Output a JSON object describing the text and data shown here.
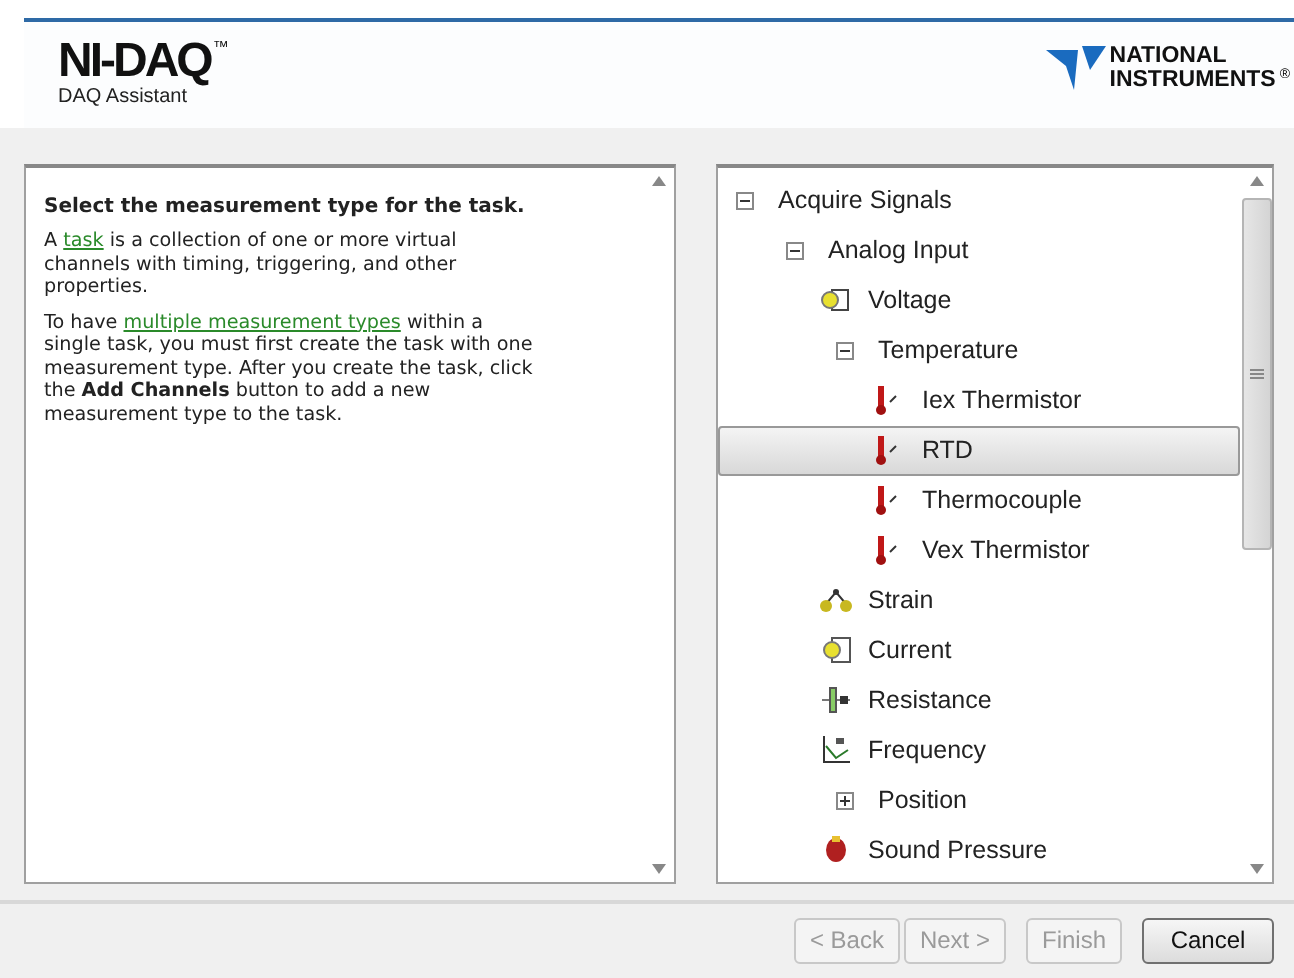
{
  "header": {
    "product": "NI-DAQ",
    "product_mark": "™",
    "subtitle": "DAQ Assistant",
    "vendor_lines": [
      "NATIONAL",
      "INSTRUMENTS"
    ],
    "vendor_mark": "®"
  },
  "help": {
    "heading": "Select the measurement type for the task.",
    "paragraphs": [
      {
        "parts": [
          {
            "text": "A "
          },
          {
            "text": "task",
            "link": true
          },
          {
            "text": " is a collection of one or more virtual channels with timing, triggering, and other properties."
          }
        ]
      },
      {
        "parts": [
          {
            "text": "To have "
          },
          {
            "text": "multiple measurement types",
            "link": true
          },
          {
            "text": " within a single task, you must first create the task with one measurement type. After you create the task, click the **Add Channels** button to add a new measurement type to the task."
          }
        ]
      }
    ]
  },
  "tree": [
    {
      "label": "Acquire Signals",
      "kind": "group",
      "expanded": true,
      "selected": false,
      "children": [
        {
          "label": "Analog Input",
          "kind": "group",
          "expanded": true,
          "selected": false,
          "children": [
            {
              "label": "Voltage",
              "kind": "voltage",
              "selected": false
            },
            {
              "label": "Temperature",
              "kind": "group",
              "expanded": true,
              "selected": false,
              "children": [
                {
                  "label": "Iex Thermistor",
                  "kind": "thermometer",
                  "selected": false
                },
                {
                  "label": "RTD",
                  "kind": "thermometer",
                  "selected": true
                },
                {
                  "label": "Thermocouple",
                  "kind": "thermometer",
                  "selected": false
                },
                {
                  "label": "Vex Thermistor",
                  "kind": "thermometer",
                  "selected": false
                }
              ]
            },
            {
              "label": "Strain",
              "kind": "strain",
              "selected": false
            },
            {
              "label": "Current",
              "kind": "current",
              "selected": false
            },
            {
              "label": "Resistance",
              "kind": "resistance",
              "selected": false
            },
            {
              "label": "Frequency",
              "kind": "frequency",
              "selected": false
            },
            {
              "label": "Position",
              "kind": "group",
              "expanded": false,
              "selected": false
            },
            {
              "label": "Sound Pressure",
              "kind": "sound",
              "selected": false
            }
          ]
        }
      ]
    }
  ],
  "buttons": [
    {
      "label": "< Back",
      "disabled": true
    },
    {
      "label": "Next >",
      "disabled": true
    },
    {
      "label": "Finish",
      "disabled": true
    },
    {
      "label": "Cancel",
      "disabled": false
    }
  ]
}
